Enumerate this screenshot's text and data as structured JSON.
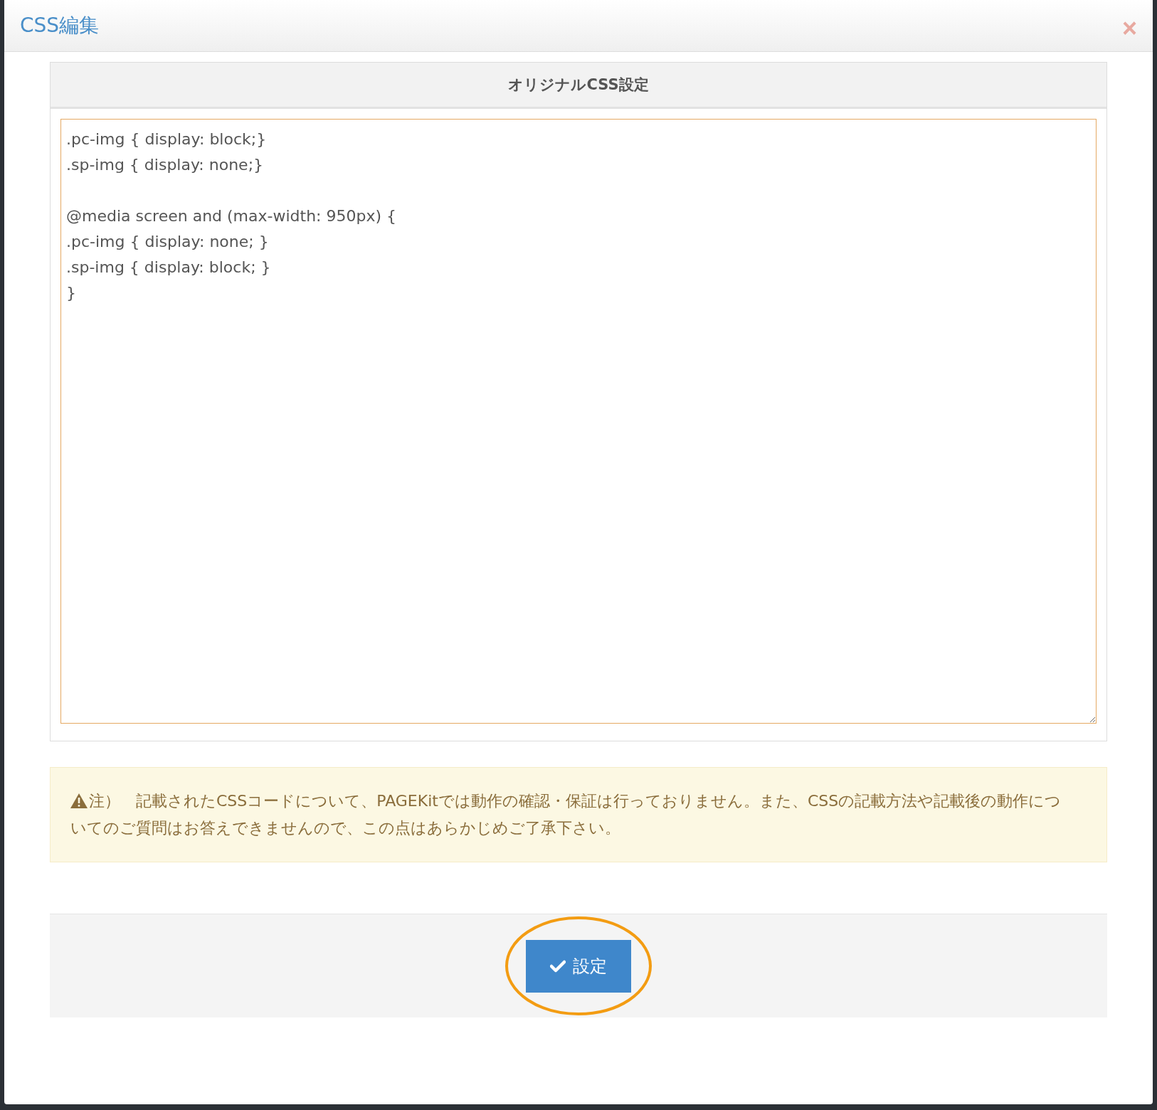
{
  "dialog": {
    "title": "CSS編集",
    "close": "×"
  },
  "panel": {
    "heading": "オリジナルCSS設定",
    "code_blocks": [
      [
        ".pc-img { display: block;}",
        ".sp-img { display: none;}"
      ],
      [
        "@media screen and (max-width: 950px) {",
        ".pc-img { display: none; }",
        ".sp-img { display: block; }",
        "}"
      ]
    ]
  },
  "notice": {
    "text": "注）　記載されたCSSコードについて、PAGEKitでは動作の確認・保証は行っておりません。また、CSSの記載方法や記載後の動作についてのご質問はお答えできませんので、この点はあらかじめご了承下さい。"
  },
  "footer": {
    "button": "設定",
    "highlighted": true
  }
}
